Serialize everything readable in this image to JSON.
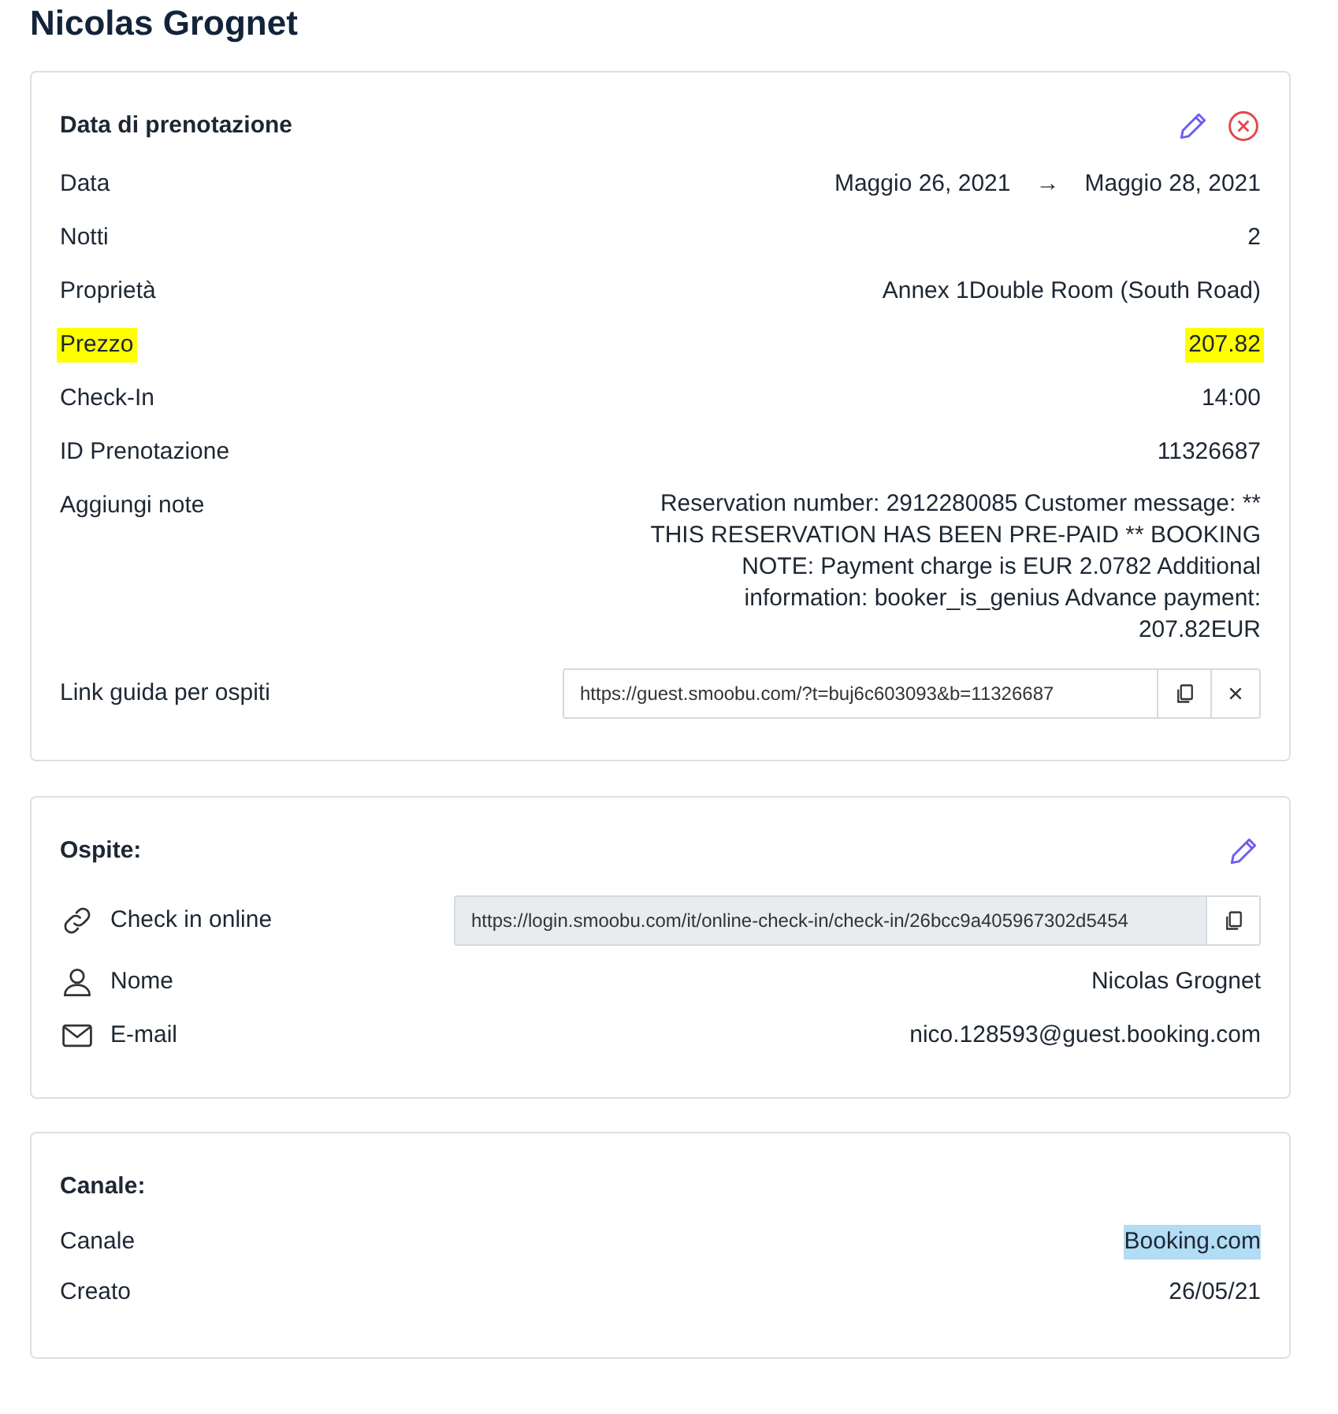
{
  "title": "Nicolas Grognet",
  "booking": {
    "heading": "Data di prenotazione",
    "rows": [
      {
        "kind": "dates",
        "label": "Data",
        "from": "Maggio 26, 2021",
        "arrow": "→",
        "to": "Maggio 28, 2021",
        "highlighted": false
      },
      {
        "kind": "text",
        "label": "Notti",
        "value": "2",
        "highlighted": false
      },
      {
        "kind": "text",
        "label": "Proprietà",
        "value": "Annex 1Double Room (South Road)",
        "highlighted": false
      },
      {
        "kind": "text",
        "label": "Prezzo",
        "value": "207.82",
        "highlighted": true
      },
      {
        "kind": "text",
        "label": "Check-In",
        "value": "14:00",
        "highlighted": false
      },
      {
        "kind": "text",
        "label": "ID Prenotazione",
        "value": "11326687",
        "highlighted": false
      },
      {
        "kind": "note",
        "label": "Aggiungi note",
        "value": "Reservation number: 2912280085 Customer message: ** THIS RESERVATION HAS BEEN PRE-PAID ** BOOKING NOTE: Payment charge is EUR 2.0782 Additional information: booker_is_genius Advance payment: 207.82EUR",
        "highlighted": false
      },
      {
        "kind": "link",
        "label": "Link guida per ospiti",
        "value": "https://guest.smoobu.com/?t=buj6c603093&b=11326687",
        "highlighted": false
      }
    ]
  },
  "guest": {
    "heading": "Ospite:",
    "rows": [
      {
        "kind": "checkin",
        "label": "Check in online",
        "value": "https://login.smoobu.com/it/online-check-in/check-in/26bcc9a405967302d5454"
      },
      {
        "kind": "name",
        "label": "Nome",
        "value": "Nicolas Grognet"
      },
      {
        "kind": "email",
        "label": "E-mail",
        "value": "nico.128593@guest.booking.com"
      }
    ]
  },
  "channel": {
    "heading": "Canale:",
    "rows": [
      {
        "label": "Canale",
        "value": "Booking.com",
        "text_selected": true
      },
      {
        "label": "Creato",
        "value": "26/05/21",
        "text_selected": false
      }
    ]
  }
}
